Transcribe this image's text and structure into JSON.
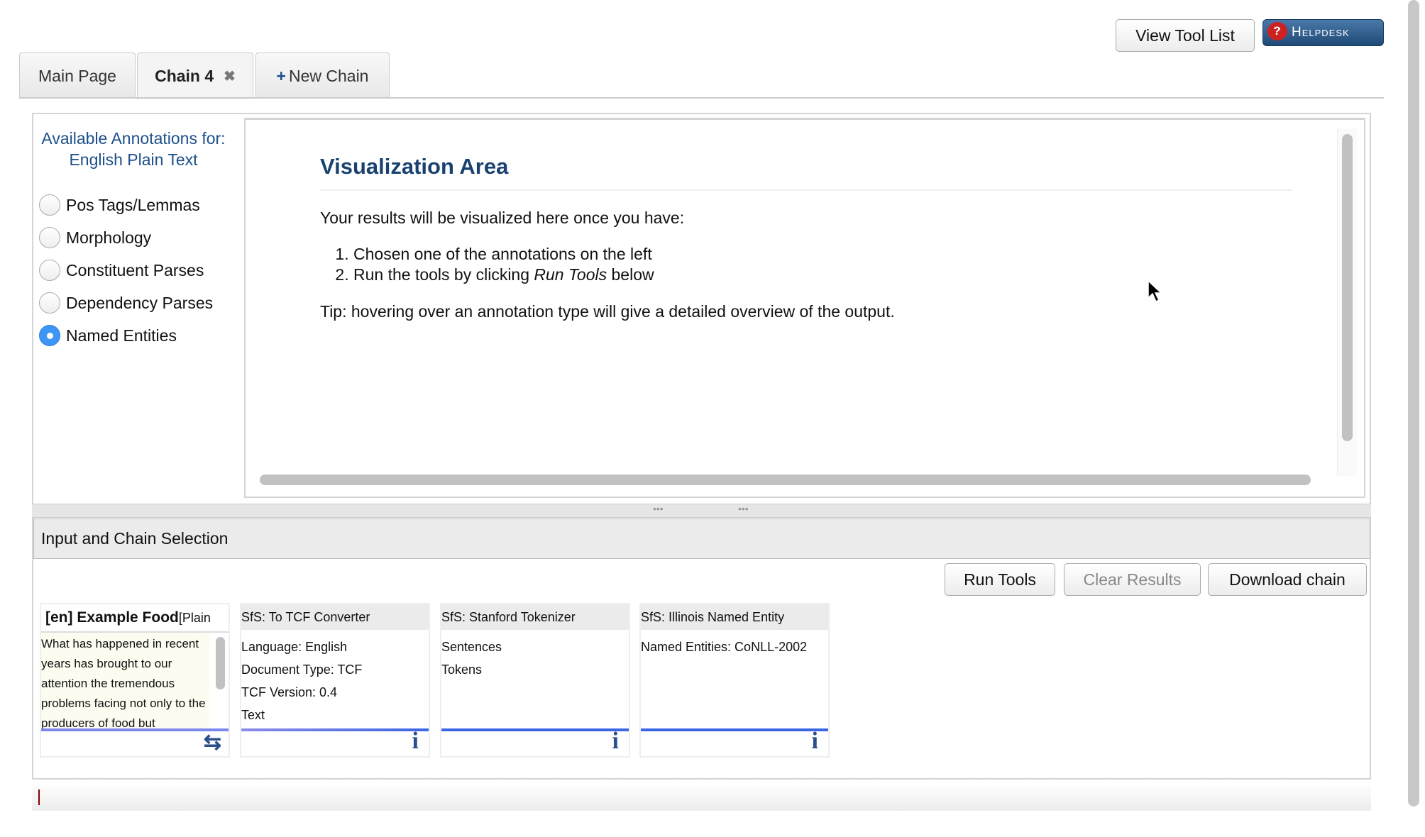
{
  "header": {
    "view_tool_list": "View Tool List",
    "helpdesk": "Helpdesk"
  },
  "tabs": [
    {
      "label": "Main Page"
    },
    {
      "label": "Chain 4",
      "close": "✖"
    },
    {
      "label": "New Chain",
      "icon": "+"
    }
  ],
  "sidebar": {
    "title_line1": "Available Annotations for:",
    "title_line2": "English Plain Text",
    "options": [
      {
        "label": "Pos Tags/Lemmas",
        "selected": false
      },
      {
        "label": "Morphology",
        "selected": false
      },
      {
        "label": "Constituent Parses",
        "selected": false
      },
      {
        "label": "Dependency Parses",
        "selected": false
      },
      {
        "label": "Named Entities",
        "selected": true
      }
    ]
  },
  "viz": {
    "title": "Visualization Area",
    "intro": "Your results will be visualized here once you have:",
    "step1": "Chosen one of the annotations on the left",
    "step2_pre": "Run the tools by clicking ",
    "step2_em": "Run Tools",
    "step2_post": " below",
    "tip": "Tip: hovering over an annotation type will give a detailed overview of the output."
  },
  "chain": {
    "title": "Input and Chain Selection",
    "run": "Run Tools",
    "clear": "Clear Results",
    "download": "Download chain",
    "input": {
      "title_bold": "[en] Example Food",
      "title_rest": " [Plain",
      "text": "What has happened in recent years has brought to our attention the tremendous problems facing not only to the producers of food but"
    },
    "tools": [
      {
        "name": "SfS: To TCF Converter",
        "lines": [
          "Language: English",
          "Document Type: TCF",
          "TCF Version: 0.4",
          "Text"
        ]
      },
      {
        "name": "SfS: Stanford Tokenizer",
        "lines": [
          "Sentences",
          "Tokens"
        ]
      },
      {
        "name": "SfS: Illinois Named Entity",
        "lines": [
          "Named Entities: CoNLL-2002"
        ]
      }
    ]
  },
  "colors": {
    "accent": "#3d95f5",
    "title": "#1a416f",
    "bar": "#3a66e6"
  }
}
